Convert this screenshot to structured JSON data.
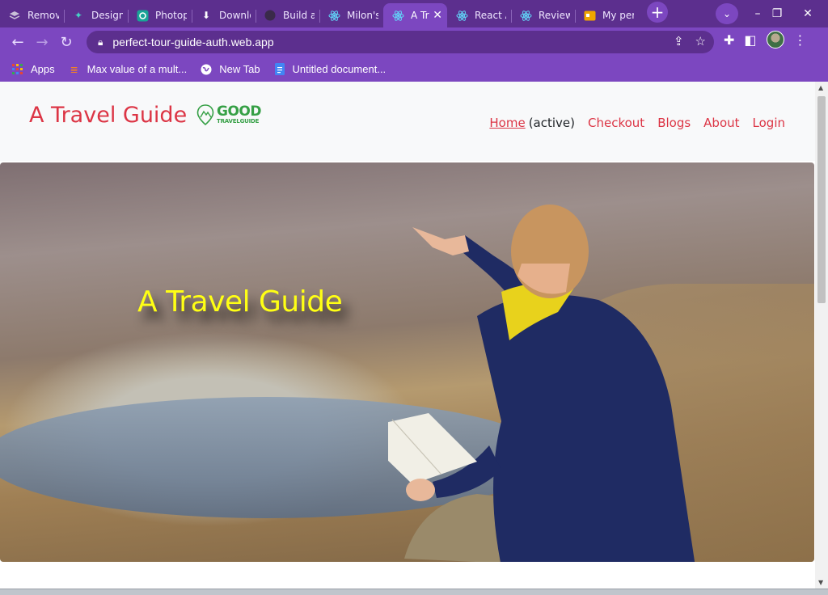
{
  "browser": {
    "tabs": [
      {
        "label": "Remov",
        "icon": "layers-icon",
        "color": "#c9c0d8"
      },
      {
        "label": "Design",
        "icon": "sparkle-icon",
        "color": "#46d2c6"
      },
      {
        "label": "Photop",
        "icon": "photopea-icon",
        "color": "#38c6a6"
      },
      {
        "label": "Downlo",
        "icon": "download-icon",
        "color": "#ffffff"
      },
      {
        "label": "Build a",
        "icon": "github-icon",
        "color": "#333333"
      },
      {
        "label": "Milon's",
        "icon": "react-icon",
        "color": "#61dafb"
      },
      {
        "label": "A Tr",
        "icon": "react-icon",
        "color": "#61dafb"
      },
      {
        "label": "React A",
        "icon": "react-icon",
        "color": "#61dafb"
      },
      {
        "label": "Review",
        "icon": "react-icon",
        "color": "#61dafb"
      },
      {
        "label": "My per",
        "icon": "portfolio-icon",
        "color": "#f0a500"
      }
    ],
    "active_tab_index": 6,
    "url": "perfect-tour-guide-auth.web.app",
    "bookmarks": [
      {
        "label": "Apps",
        "icon": "apps-grid-icon"
      },
      {
        "label": "Max value of a mult...",
        "icon": "stackoverflow-icon"
      },
      {
        "label": "New Tab",
        "icon": "globe-icon"
      },
      {
        "label": "Untitled document...",
        "icon": "docs-icon"
      }
    ]
  },
  "site": {
    "brand": "A Travel Guide",
    "logo": {
      "word1": "GOOD",
      "word2": "TRAVELGUIDE"
    },
    "nav": [
      {
        "label": "Home",
        "active": true
      },
      {
        "label": "Checkout",
        "active": false
      },
      {
        "label": "Blogs",
        "active": false
      },
      {
        "label": "About",
        "active": false
      },
      {
        "label": "Login",
        "active": false
      }
    ],
    "active_marker": "(active)",
    "hero_title": "A Travel Guide"
  },
  "colors": {
    "brand_red": "#dc3545",
    "hero_title_yellow": "#ffff14",
    "chrome_purple": "#7c47c0",
    "logo_green": "#36a046"
  }
}
